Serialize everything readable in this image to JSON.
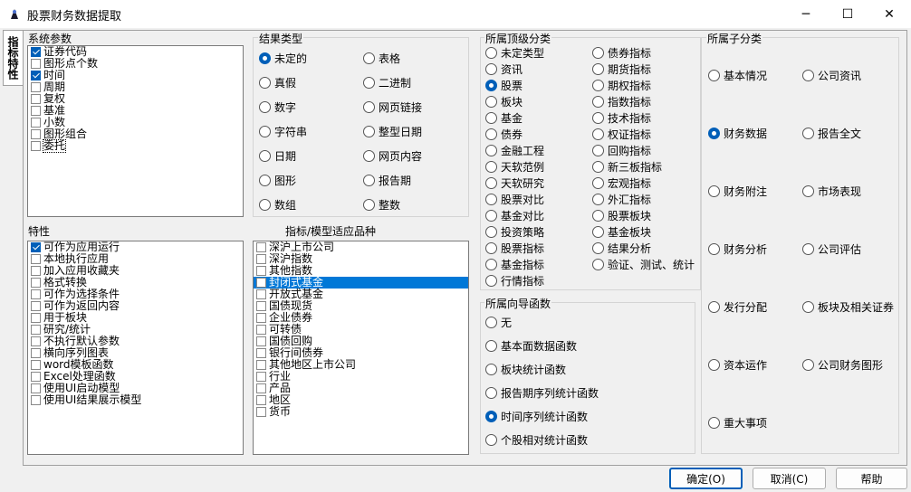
{
  "window": {
    "title": "股票财务数据提取",
    "minimize": "─",
    "maximize": "☐",
    "close": "✕"
  },
  "tab": {
    "label": "指标特性"
  },
  "system_params": {
    "title": "系统参数",
    "items": [
      {
        "label": "证券代码",
        "checked": true
      },
      {
        "label": "图形点个数",
        "checked": false
      },
      {
        "label": "时间",
        "checked": true
      },
      {
        "label": "周期",
        "checked": false
      },
      {
        "label": "复权",
        "checked": false
      },
      {
        "label": "基准",
        "checked": false
      },
      {
        "label": "小数",
        "checked": false
      },
      {
        "label": "图形组合",
        "checked": false
      },
      {
        "label": "委托",
        "checked": false
      }
    ]
  },
  "result_type": {
    "title": "结果类型",
    "options": [
      "未定的",
      "表格",
      "真假",
      "二进制",
      "数字",
      "网页链接",
      "字符串",
      "整型日期",
      "日期",
      "网页内容",
      "图形",
      "报告期",
      "数组",
      "整数"
    ],
    "selected": "未定的"
  },
  "properties": {
    "title": "特性",
    "items": [
      {
        "label": "可作为应用运行",
        "checked": true
      },
      {
        "label": "本地执行应用",
        "checked": false
      },
      {
        "label": "加入应用收藏夹",
        "checked": false
      },
      {
        "label": "格式转换",
        "checked": false
      },
      {
        "label": "可作为选择条件",
        "checked": false
      },
      {
        "label": "可作为返回内容",
        "checked": false
      },
      {
        "label": "用于板块",
        "checked": false
      },
      {
        "label": "研究/统计",
        "checked": false
      },
      {
        "label": "不执行默认参数",
        "checked": false
      },
      {
        "label": "横向序列图表",
        "checked": false
      },
      {
        "label": "word模板函数",
        "checked": false
      },
      {
        "label": "Excel处理函数",
        "checked": false
      },
      {
        "label": "使用UI启动模型",
        "checked": false
      },
      {
        "label": "使用UI结果展示模型",
        "checked": false
      }
    ]
  },
  "varieties": {
    "title": "指标/模型适应品种",
    "items": [
      {
        "label": "深沪上市公司",
        "checked": false
      },
      {
        "label": "深沪指数",
        "checked": false
      },
      {
        "label": "其他指数",
        "checked": false
      },
      {
        "label": "封闭式基金",
        "checked": false,
        "selected": true
      },
      {
        "label": "开放式基金",
        "checked": false
      },
      {
        "label": "国债现货",
        "checked": false
      },
      {
        "label": "企业债券",
        "checked": false
      },
      {
        "label": "可转债",
        "checked": false
      },
      {
        "label": "国债回购",
        "checked": false
      },
      {
        "label": "银行间债券",
        "checked": false
      },
      {
        "label": "其他地区上市公司",
        "checked": false
      },
      {
        "label": "行业",
        "checked": false
      },
      {
        "label": "产品",
        "checked": false
      },
      {
        "label": "地区",
        "checked": false
      },
      {
        "label": "货币",
        "checked": false
      }
    ]
  },
  "top_category": {
    "title": "所属顶级分类",
    "col1": [
      "未定类型",
      "资讯",
      "股票",
      "板块",
      "基金",
      "债券",
      "金融工程",
      "天软范例",
      "天软研究",
      "股票对比",
      "基金对比",
      "投资策略",
      "股票指标",
      "基金指标",
      "行情指标"
    ],
    "col2": [
      "债券指标",
      "期货指标",
      "期权指标",
      "指数指标",
      "技术指标",
      "权证指标",
      "回购指标",
      "新三板指标",
      "宏观指标",
      "外汇指标",
      "股票板块",
      "基金板块",
      "结果分析",
      "验证、测试、统计"
    ],
    "selected": "股票"
  },
  "wizard": {
    "title": "所属向导函数",
    "options": [
      "无",
      "基本面数据函数",
      "板块统计函数",
      "报告期序列统计函数",
      "时间序列统计函数",
      "个股相对统计函数"
    ],
    "selected": "时间序列统计函数"
  },
  "sub_category": {
    "title": "所属子分类",
    "col1": [
      "基本情况",
      "财务数据",
      "财务附注",
      "财务分析",
      "发行分配",
      "资本运作",
      "重大事项"
    ],
    "col2": [
      "公司资讯",
      "报告全文",
      "市场表现",
      "公司评估",
      "板块及相关证券",
      "公司财务图形"
    ],
    "selected": "财务数据"
  },
  "buttons": {
    "ok": "确定(O)",
    "cancel": "取消(C)",
    "help": "帮助"
  }
}
